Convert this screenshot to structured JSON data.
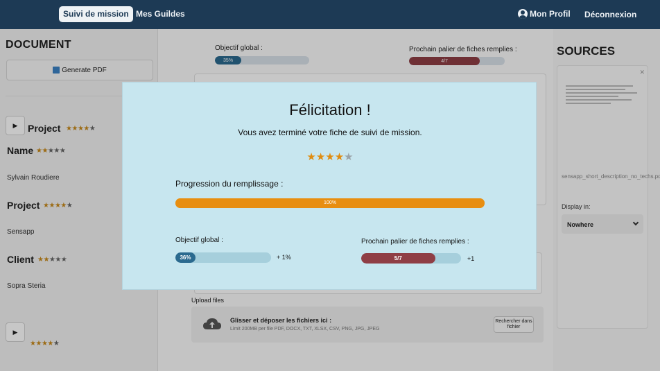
{
  "nav": {
    "tabs": [
      {
        "label": "Suivi de mission",
        "active": true
      },
      {
        "label": "Mes Guildes",
        "active": false
      }
    ],
    "profile_label": "Mon Profil",
    "logout_label": "Déconnexion",
    "background_color": "#1d3a55"
  },
  "sidebar": {
    "title": "DOCUMENT",
    "generate_pdf_label": "Generate PDF",
    "sections": [
      {
        "label": "Project",
        "stars": 4
      },
      {
        "label": "Name",
        "stars": 2,
        "value": "Sylvain Roudiere"
      },
      {
        "label": "Project",
        "stars": 4,
        "value": "Sensapp"
      },
      {
        "label": "Client",
        "stars": 2,
        "value": "Sopra Steria"
      },
      {
        "stars": 4
      }
    ],
    "star_max": 5
  },
  "main": {
    "objectif_label": "Objectif global :",
    "objectif_value": "35%",
    "objectif_fraction": 0.28,
    "palier_label": "Prochain palier de fiches remplies :",
    "palier_value": "4/7",
    "palier_fraction": 0.74,
    "upload_label": "Upload files",
    "drop_title": "Glisser et déposer les fichiers ici :",
    "drop_subtitle": "Limit 200MB per file PDF, DOCX, TXT, XLSX, CSV, PNG, JPG, JPEG",
    "browse_label": "Rechercher dans fichier"
  },
  "sources": {
    "title": "SOURCES",
    "file_name": "sensapp_short_description_no_techs.pdf",
    "display_label": "Display in:",
    "display_value": "Nowhere"
  },
  "modal": {
    "title": "Félicitation !",
    "subtitle": "Vous avez terminé votre fiche de suivi de mission.",
    "stars": 4,
    "star_max": 5,
    "progress_label": "Progression du remplissage :",
    "progress_value": "100%",
    "progress_fraction": 1.0,
    "objectif_label": "Objectif global :",
    "objectif_value": "36%",
    "objectif_fraction": 0.21,
    "objectif_delta": "+ 1%",
    "palier_label": "Prochain palier de fiches remplies :",
    "palier_value": "5/7",
    "palier_fraction": 0.74,
    "palier_delta": "+1",
    "background_color": "#c7e6ef",
    "accent_color": "#e88e10",
    "objectif_color": "#2b6a8f",
    "palier_color": "#8f3e45"
  }
}
